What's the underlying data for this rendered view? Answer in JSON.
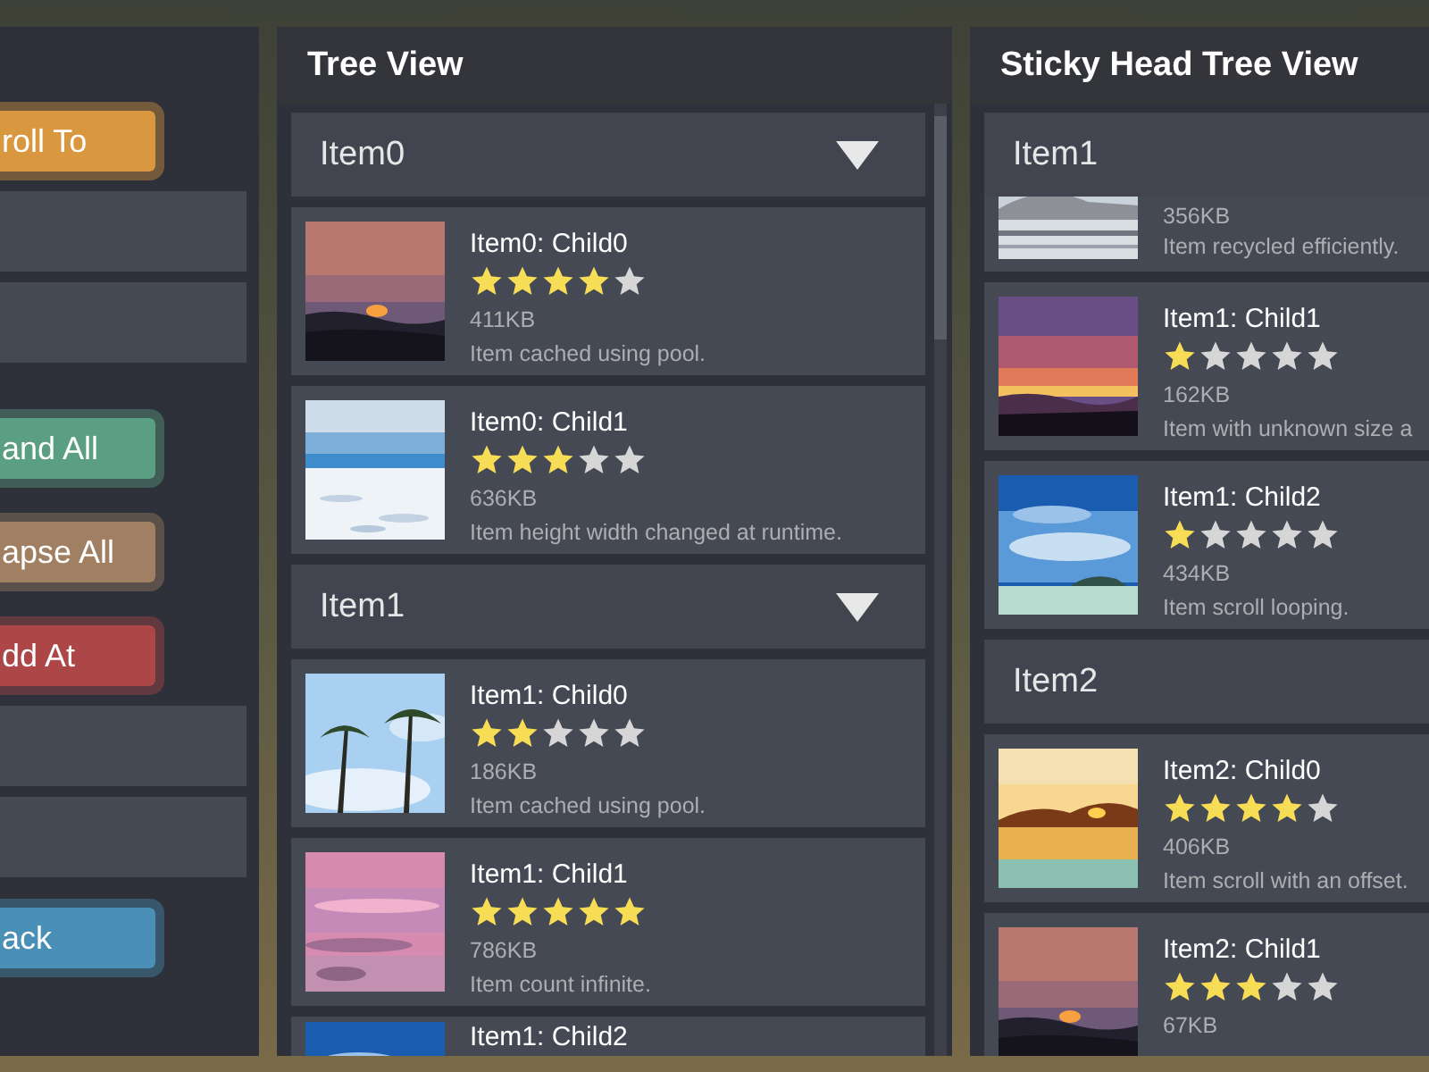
{
  "left_panel": {
    "controls": [
      {
        "kind": "button",
        "label": "roll To",
        "color": "#d9983f"
      },
      {
        "kind": "field"
      },
      {
        "kind": "field"
      },
      {
        "kind": "button",
        "label": "and All",
        "color": "#5a9f83"
      },
      {
        "kind": "button",
        "label": "apse All",
        "color": "#a07f63"
      },
      {
        "kind": "button",
        "label": "dd At",
        "color": "#ad4646"
      },
      {
        "kind": "field"
      },
      {
        "kind": "field"
      },
      {
        "kind": "button",
        "label": "ack",
        "color": "#4a8fb6"
      }
    ]
  },
  "tree_view": {
    "title": "Tree View",
    "groups": [
      {
        "label": "Item0",
        "expanded": true,
        "children": [
          {
            "title": "Item0: Child0",
            "stars": 4,
            "size": "411KB",
            "note": "Item cached using pool."
          },
          {
            "title": "Item0: Child1",
            "stars": 3,
            "size": "636KB",
            "note": "Item height width changed at runtime."
          }
        ]
      },
      {
        "label": "Item1",
        "expanded": true,
        "children": [
          {
            "title": "Item1: Child0",
            "stars": 2,
            "size": "186KB",
            "note": "Item cached using pool."
          },
          {
            "title": "Item1: Child1",
            "stars": 5,
            "size": "786KB",
            "note": "Item count infinite."
          },
          {
            "title": "Item1: Child2"
          }
        ]
      }
    ]
  },
  "sticky_tree_view": {
    "title": "Sticky Head Tree View",
    "groups": [
      {
        "label": "Item1",
        "children": [
          {
            "size": "356KB",
            "note": "Item recycled efficiently."
          },
          {
            "title": "Item1: Child1",
            "stars": 1,
            "size": "162KB",
            "note": "Item with unknown size a"
          },
          {
            "title": "Item1: Child2",
            "stars": 1,
            "size": "434KB",
            "note": "Item scroll looping."
          }
        ]
      },
      {
        "label": "Item2",
        "children": [
          {
            "title": "Item2: Child0",
            "stars": 4,
            "size": "406KB",
            "note": "Item scroll with an offset."
          },
          {
            "title": "Item2: Child1",
            "stars": 3,
            "size": "67KB"
          }
        ]
      }
    ]
  }
}
